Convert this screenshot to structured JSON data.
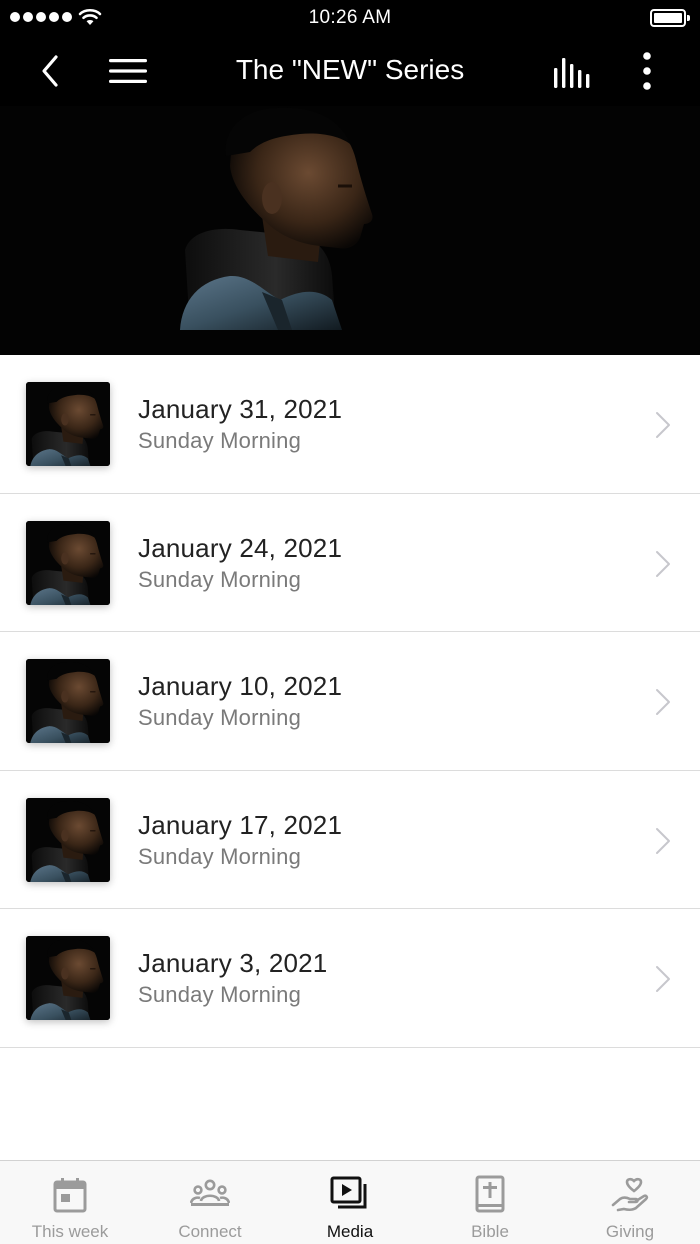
{
  "status_bar": {
    "time": "10:26 AM"
  },
  "nav": {
    "title": "The \"NEW\" Series"
  },
  "episodes": [
    {
      "date": "January 31, 2021",
      "service": "Sunday Morning"
    },
    {
      "date": "January 24, 2021",
      "service": "Sunday Morning"
    },
    {
      "date": "January 10, 2021",
      "service": "Sunday Morning"
    },
    {
      "date": "January 17, 2021",
      "service": "Sunday Morning"
    },
    {
      "date": "January 3, 2021",
      "service": "Sunday Morning"
    }
  ],
  "tabs": [
    {
      "label": "This week",
      "icon": "calendar-icon",
      "active": false
    },
    {
      "label": "Connect",
      "icon": "people-icon",
      "active": false
    },
    {
      "label": "Media",
      "icon": "media-icon",
      "active": true
    },
    {
      "label": "Bible",
      "icon": "bible-icon",
      "active": false
    },
    {
      "label": "Giving",
      "icon": "giving-heart-hand-icon",
      "active": false
    }
  ],
  "colors": {
    "header_background": "#000000",
    "active_tab": "#111111",
    "inactive_tab": "#9b9b9b",
    "subtitle_text": "#7a7a7a"
  }
}
